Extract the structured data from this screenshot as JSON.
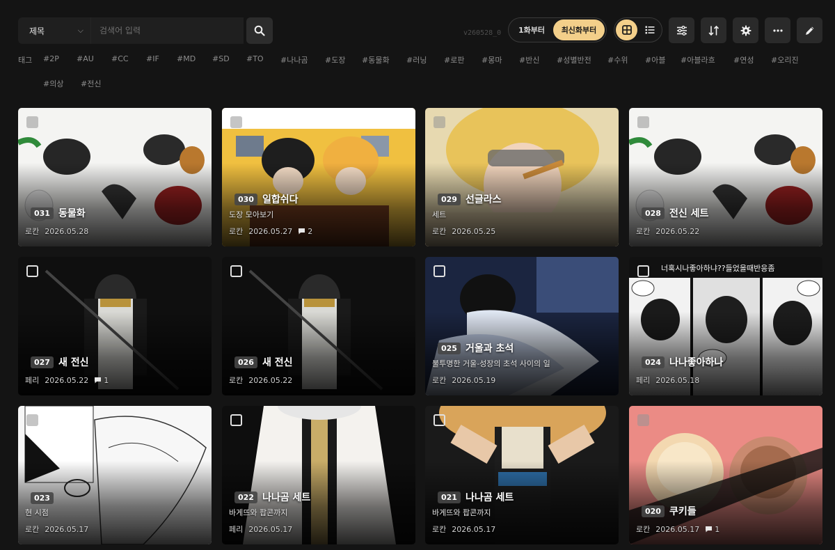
{
  "search": {
    "field": "제목",
    "placeholder": "검색어 입력"
  },
  "version": "v260528_0",
  "order": {
    "first_label": "1화부터",
    "latest_label": "최신화부터",
    "active": "latest"
  },
  "view": {
    "active": "grid"
  },
  "toolbar_icons": [
    "filter-icon",
    "sort-icon",
    "gear-icon",
    "more-icon",
    "pencil-icon"
  ],
  "tags": {
    "label": "태그",
    "items": [
      "#2P",
      "#AU",
      "#CC",
      "#IF",
      "#MD",
      "#SD",
      "#TO",
      "#나나곰",
      "#도장",
      "#동물화",
      "#러닝",
      "#로판",
      "#몽마",
      "#반신",
      "#성별반전",
      "#수위",
      "#아블",
      "#아블라흐",
      "#연성",
      "#오리진",
      "#의상",
      "#전신"
    ]
  },
  "cards": [
    {
      "num": "031",
      "title": "동물화",
      "sub": "",
      "author": "로칸",
      "date": "2026.05.28",
      "comments": "",
      "check": "filled",
      "art": "white"
    },
    {
      "num": "030",
      "title": "일합쉬다",
      "sub": "도장 모아보기",
      "author": "로칸",
      "date": "2026.05.27",
      "comments": "2",
      "check": "filled",
      "art": "office"
    },
    {
      "num": "029",
      "title": "선글라스",
      "sub": "세트",
      "author": "로칸",
      "date": "2026.05.25",
      "comments": "",
      "check": "filled",
      "art": "gold"
    },
    {
      "num": "028",
      "title": "전신 세트",
      "sub": "",
      "author": "로칸",
      "date": "2026.05.22",
      "comments": "",
      "check": "filled",
      "art": "white"
    },
    {
      "num": "027",
      "title": "새 전신",
      "sub": "",
      "author": "페리",
      "date": "2026.05.22",
      "comments": "1",
      "check": "outline",
      "art": "dark"
    },
    {
      "num": "026",
      "title": "새 전신",
      "sub": "",
      "author": "로칸",
      "date": "2026.05.22",
      "comments": "",
      "check": "outline",
      "art": "dark"
    },
    {
      "num": "025",
      "title": "거울과 초석",
      "sub": "불투명한 거울-성장의 초석 사이의 일",
      "author": "로칸",
      "date": "2026.05.19",
      "comments": "",
      "check": "outline",
      "art": "night"
    },
    {
      "num": "024",
      "title": "나나좋아하나",
      "sub": "",
      "author": "페리",
      "date": "2026.05.18",
      "comments": "",
      "check": "outline",
      "art": "comic",
      "caption": "너혹시나좋아하냐??들었을때반응좀"
    },
    {
      "num": "023",
      "title": "",
      "sub": "현 시점",
      "author": "로칸",
      "date": "2026.05.17",
      "comments": "",
      "check": "filled",
      "art": "sketch"
    },
    {
      "num": "022",
      "title": "나나곰 세트",
      "sub": "바게뜨와 팝콘까지",
      "author": "페리",
      "date": "2026.05.17",
      "comments": "",
      "check": "outline",
      "art": "robe"
    },
    {
      "num": "021",
      "title": "나나곰 세트",
      "sub": "바게뜨와 팝콘까지",
      "author": "로칸",
      "date": "2026.05.17",
      "comments": "",
      "check": "outline",
      "art": "darkrobe"
    },
    {
      "num": "020",
      "title": "쿠키들",
      "sub": "",
      "author": "로칸",
      "date": "2026.05.17",
      "comments": "1",
      "check": "filled",
      "art": "pink"
    }
  ]
}
